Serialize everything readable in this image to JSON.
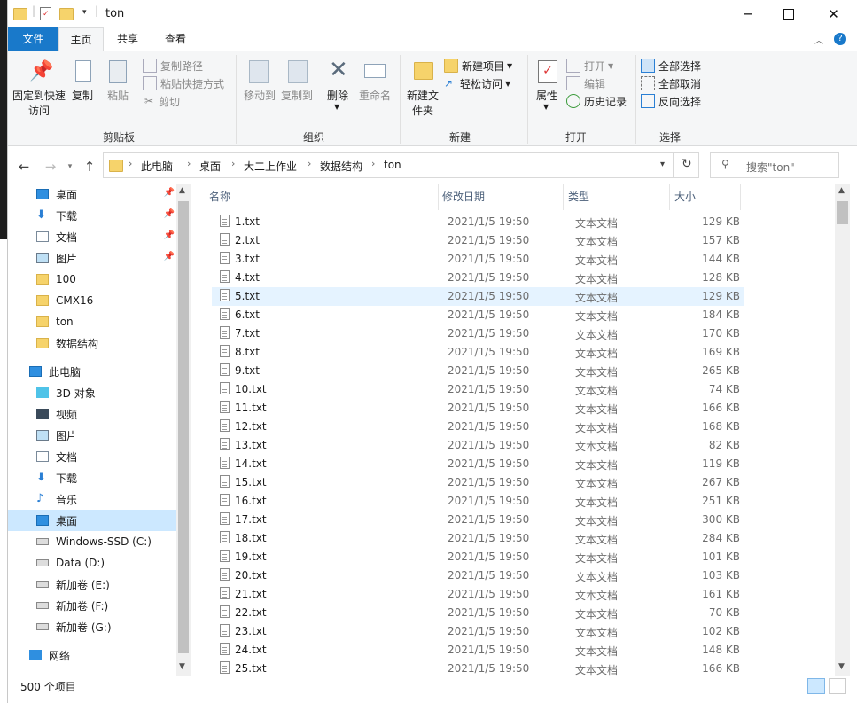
{
  "window": {
    "title": "ton"
  },
  "ribbon_tabs": [
    "文件",
    "主页",
    "共享",
    "查看"
  ],
  "ribbon": {
    "clipboard": {
      "pin_label": "固定到快速访问",
      "copy": "复制",
      "paste": "粘贴",
      "copy_path": "复制路径",
      "paste_shortcut": "粘贴快捷方式",
      "cut": "剪切",
      "group": "剪贴板"
    },
    "organize": {
      "move_to": "移动到",
      "copy_to": "复制到",
      "delete": "删除",
      "rename": "重命名",
      "group": "组织"
    },
    "new": {
      "new_folder": "新建文件夹",
      "new_item": "新建项目",
      "easy_access": "轻松访问",
      "group": "新建"
    },
    "open": {
      "properties": "属性",
      "open": "打开",
      "edit": "编辑",
      "history": "历史记录",
      "group": "打开"
    },
    "select": {
      "select_all": "全部选择",
      "select_none": "全部取消",
      "invert": "反向选择",
      "group": "选择"
    }
  },
  "address": {
    "crumbs": [
      "此电脑",
      "桌面",
      "大二上作业",
      "数据结构",
      "ton"
    ],
    "search_placeholder": "搜索\"ton\""
  },
  "nav": {
    "quick": [
      {
        "label": "桌面",
        "icon": "desktop-icon",
        "pinned": true
      },
      {
        "label": "下载",
        "icon": "download-icon",
        "pinned": true
      },
      {
        "label": "文档",
        "icon": "document-icon",
        "pinned": true
      },
      {
        "label": "图片",
        "icon": "picture-icon",
        "pinned": true
      },
      {
        "label": "100_",
        "icon": "folder-icon",
        "pinned": false
      },
      {
        "label": "CMX16",
        "icon": "folder-icon",
        "pinned": false
      },
      {
        "label": "ton",
        "icon": "folder-icon",
        "pinned": false
      },
      {
        "label": "数据结构",
        "icon": "folder-icon",
        "pinned": false
      }
    ],
    "this_pc": "此电脑",
    "pc_items": [
      {
        "label": "3D 对象",
        "icon": "cube-icon"
      },
      {
        "label": "视频",
        "icon": "video-icon"
      },
      {
        "label": "图片",
        "icon": "picture-icon"
      },
      {
        "label": "文档",
        "icon": "document-icon"
      },
      {
        "label": "下载",
        "icon": "download-icon"
      },
      {
        "label": "音乐",
        "icon": "music-icon"
      },
      {
        "label": "桌面",
        "icon": "desktop-icon",
        "selected": true
      },
      {
        "label": "Windows-SSD (C:)",
        "icon": "drive-icon"
      },
      {
        "label": "Data (D:)",
        "icon": "drive-icon"
      },
      {
        "label": "新加卷 (E:)",
        "icon": "drive-icon"
      },
      {
        "label": "新加卷 (F:)",
        "icon": "drive-icon"
      },
      {
        "label": "新加卷 (G:)",
        "icon": "drive-icon"
      }
    ],
    "network": "网络"
  },
  "columns": {
    "name": "名称",
    "date": "修改日期",
    "type": "类型",
    "size": "大小"
  },
  "files": [
    {
      "name": "1.txt",
      "date": "2021/1/5 19:50",
      "type": "文本文档",
      "size": "129 KB"
    },
    {
      "name": "2.txt",
      "date": "2021/1/5 19:50",
      "type": "文本文档",
      "size": "157 KB"
    },
    {
      "name": "3.txt",
      "date": "2021/1/5 19:50",
      "type": "文本文档",
      "size": "144 KB"
    },
    {
      "name": "4.txt",
      "date": "2021/1/5 19:50",
      "type": "文本文档",
      "size": "128 KB"
    },
    {
      "name": "5.txt",
      "date": "2021/1/5 19:50",
      "type": "文本文档",
      "size": "129 KB",
      "hover": true
    },
    {
      "name": "6.txt",
      "date": "2021/1/5 19:50",
      "type": "文本文档",
      "size": "184 KB"
    },
    {
      "name": "7.txt",
      "date": "2021/1/5 19:50",
      "type": "文本文档",
      "size": "170 KB"
    },
    {
      "name": "8.txt",
      "date": "2021/1/5 19:50",
      "type": "文本文档",
      "size": "169 KB"
    },
    {
      "name": "9.txt",
      "date": "2021/1/5 19:50",
      "type": "文本文档",
      "size": "265 KB"
    },
    {
      "name": "10.txt",
      "date": "2021/1/5 19:50",
      "type": "文本文档",
      "size": "74 KB"
    },
    {
      "name": "11.txt",
      "date": "2021/1/5 19:50",
      "type": "文本文档",
      "size": "166 KB"
    },
    {
      "name": "12.txt",
      "date": "2021/1/5 19:50",
      "type": "文本文档",
      "size": "168 KB"
    },
    {
      "name": "13.txt",
      "date": "2021/1/5 19:50",
      "type": "文本文档",
      "size": "82 KB"
    },
    {
      "name": "14.txt",
      "date": "2021/1/5 19:50",
      "type": "文本文档",
      "size": "119 KB"
    },
    {
      "name": "15.txt",
      "date": "2021/1/5 19:50",
      "type": "文本文档",
      "size": "267 KB"
    },
    {
      "name": "16.txt",
      "date": "2021/1/5 19:50",
      "type": "文本文档",
      "size": "251 KB"
    },
    {
      "name": "17.txt",
      "date": "2021/1/5 19:50",
      "type": "文本文档",
      "size": "300 KB"
    },
    {
      "name": "18.txt",
      "date": "2021/1/5 19:50",
      "type": "文本文档",
      "size": "284 KB"
    },
    {
      "name": "19.txt",
      "date": "2021/1/5 19:50",
      "type": "文本文档",
      "size": "101 KB"
    },
    {
      "name": "20.txt",
      "date": "2021/1/5 19:50",
      "type": "文本文档",
      "size": "103 KB"
    },
    {
      "name": "21.txt",
      "date": "2021/1/5 19:50",
      "type": "文本文档",
      "size": "161 KB"
    },
    {
      "name": "22.txt",
      "date": "2021/1/5 19:50",
      "type": "文本文档",
      "size": "70 KB"
    },
    {
      "name": "23.txt",
      "date": "2021/1/5 19:50",
      "type": "文本文档",
      "size": "102 KB"
    },
    {
      "name": "24.txt",
      "date": "2021/1/5 19:50",
      "type": "文本文档",
      "size": "148 KB"
    },
    {
      "name": "25.txt",
      "date": "2021/1/5 19:50",
      "type": "文本文档",
      "size": "166 KB"
    }
  ],
  "status": {
    "count": "500 个项目"
  },
  "colors": {
    "accent": "#1979ca",
    "selection": "#cce8ff",
    "hover": "#e5f3ff"
  }
}
